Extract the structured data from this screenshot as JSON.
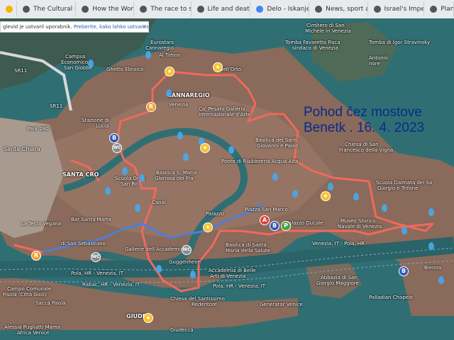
{
  "browser": {
    "tabs": [
      {
        "label": "",
        "icon": "bookmark-icon",
        "color": "#f4b400"
      },
      {
        "label": "The Cultural Revolu...",
        "icon": "web-icon",
        "color": "#555555"
      },
      {
        "label": "How the World Ban...",
        "icon": "web-icon",
        "color": "#555555"
      },
      {
        "label": "The race to save a...",
        "icon": "web-icon",
        "color": "#555555"
      },
      {
        "label": "Life and death in Pa...",
        "icon": "web-icon",
        "color": "#555555"
      },
      {
        "label": "Delo - Iskanje Goog...",
        "icon": "google-icon",
        "color": "#4285f4"
      },
      {
        "label": "News, sport and op...",
        "icon": "web-icon",
        "color": "#555555"
      },
      {
        "label": "Israel's Impending...",
        "icon": "web-icon",
        "color": "#555555"
      },
      {
        "label": "Planisi",
        "icon": "web-icon",
        "color": "#555555"
      }
    ]
  },
  "banner": {
    "text": "glevid je ustvaril uporabnik.",
    "link": "Preberite, kako lahko ustvarite svojega.",
    "close": "×"
  },
  "overlay": {
    "line1": "Pohod čez mostove",
    "line2": "Benetk . 16. 4. 2023"
  },
  "labels": {
    "campus": "Campus",
    "economico": "Economico",
    "san_giobbe": "San Giobbe",
    "ghetto": "Ghetto Ebraico",
    "eurostars": "Eurostars",
    "cannaregio_hotel": "Cannaregio",
    "timon": "Al Timon",
    "orto": "dell'Orto",
    "cannaregio": "CANNAREGIO",
    "venezia": "Venezia",
    "ca_pesaro": "Ca' Pesaro Galleria",
    "arte": "Internazionale d'Arte",
    "cimitero": "Cimitero di San",
    "michele": "Michele in Venezia",
    "stravinsky": "Tomba di Igor Stravinsky",
    "tomba_favaretto": "Tomba Favaretto Fisca",
    "sindaco": "sindaco di Venezia",
    "antonio": "Antonio",
    "nore": "nore",
    "stazione": "Stazione di",
    "lucia": "Lucia",
    "park": "Park 280",
    "santa_chiara": "Santa Chiara",
    "santa_croce": "SANTA CRO",
    "scuola_grande": "Scuola Gran",
    "san_rocco": "San Ro",
    "santa_maria_gloriosa": "Basilica S. Maria",
    "gloriosa": "Gloriosa dei Fra",
    "rialto": "Ponte di Rialto",
    "santi_giovanni": "Basilica dei Santi",
    "giovanni_paolo": "Giovanni e Paolo",
    "libreria": "Libreria Acqua Alta",
    "san_francesco": "Chiesa di San",
    "vigna": "Francesco della Vigna",
    "dalmata": "Scuola Dalmata dei Sa",
    "giorgio": "Giorgio e Trifone",
    "palazzo": "Palazzo",
    "piazza": "Piazza San Marco",
    "ducale": "Palazzo Ducale",
    "museo_storico": "Museo Storico",
    "navale": "Navale di Venezia",
    "canal": "Canal",
    "tecla": "La Tecla Vegana",
    "bar": "Bar Santa Marta",
    "sebastiano": "di San Sebastiano",
    "accademia_gal": "Gallerie dell'Accademia",
    "salute": "Basilica di Santa",
    "salute2": "Maria della Salute",
    "accademia_belle": "Accademia di Belle",
    "arti": "Arti di Venezia",
    "guggenheim": "Guggenheim",
    "pola_hr": "Pola, HR - Venezia, IT",
    "pola_it": "Venezia, IT - Pola, HR",
    "rabac": "Rabac, HR - Venezia, IT",
    "pola_hr2": "Pola, HR - Venezia, IT",
    "chiesa_santissimo": "Chiesa del Santissimo",
    "redentore": "Redentore",
    "generator": "Generator Venice",
    "abbazia": "Abbazia di San",
    "maggiore": "Giorgio Maggiore",
    "palladian": "Palladian Chapels",
    "campo": "Campo Comunale",
    "fisola": "Fisola (Città Gioli)",
    "sacca": "Sacca Fisola",
    "giudecca": "GIUDE",
    "giudecca2": "Giudecca",
    "alessia": "Alessia Pugliatti Mama",
    "africa": "Africa Venice",
    "bienna": "Bienna",
    "sr11": "SR11",
    "sr11b": "SR11"
  },
  "pins": [
    {
      "type": "R",
      "color": "#f0a030"
    },
    {
      "type": "B",
      "color": "#3458b8"
    },
    {
      "type": "WC",
      "color": "#8a8a8a"
    },
    {
      "type": "A",
      "color": "#e04040"
    },
    {
      "type": "B",
      "color": "#3458b8"
    },
    {
      "type": "P",
      "color": "#43a047"
    },
    {
      "type": "WC",
      "color": "#8a8a8a"
    },
    {
      "type": "WC",
      "color": "#8a8a8a"
    },
    {
      "type": "R",
      "color": "#f0a030"
    },
    {
      "type": "B",
      "color": "#3458b8"
    }
  ],
  "route_colors": {
    "walk": "#ef6a5c",
    "water": "#4d7fd4",
    "poi_drop": "#4aa7e8",
    "star": "#f6c12b"
  }
}
